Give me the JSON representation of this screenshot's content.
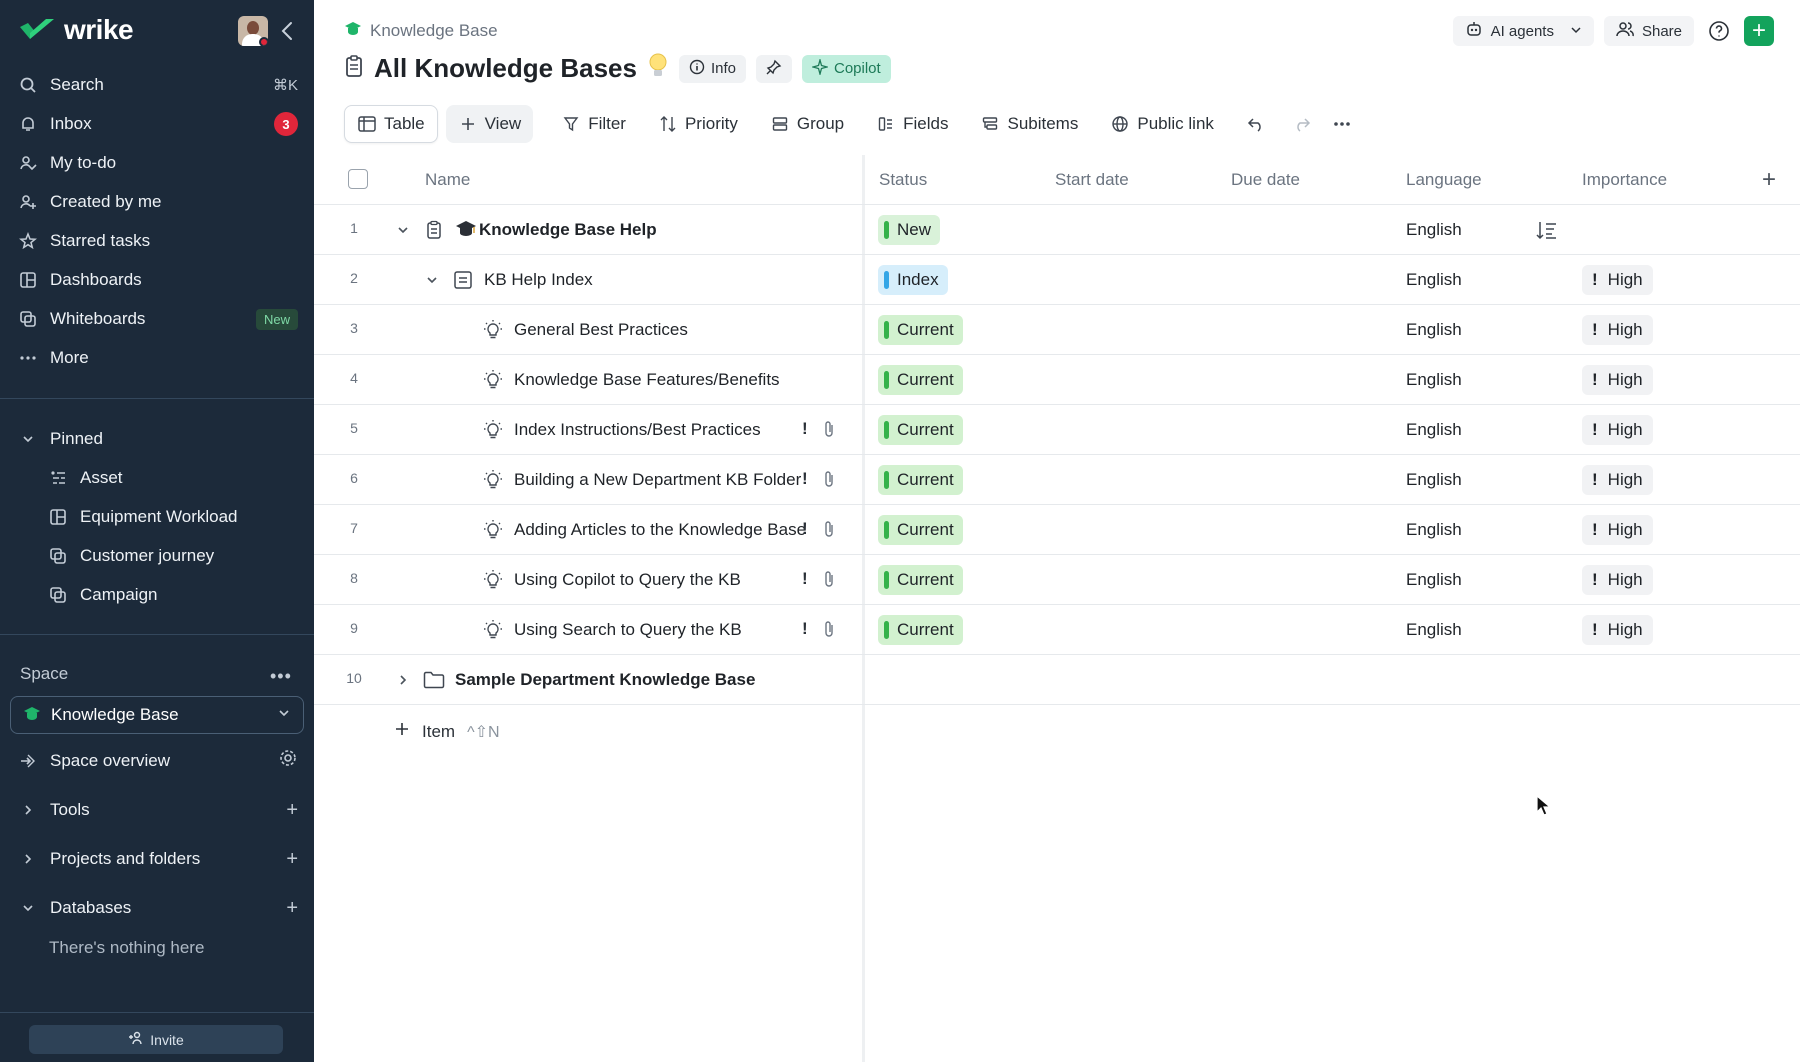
{
  "sidebar": {
    "logo": "wrike",
    "nav": [
      {
        "label": "Search",
        "shortcut": "⌘K",
        "icon": "search-icon"
      },
      {
        "label": "Inbox",
        "badge": "3",
        "icon": "bell-icon"
      },
      {
        "label": "My to-do",
        "icon": "user-check-icon"
      },
      {
        "label": "Created by me",
        "icon": "user-plus-icon"
      },
      {
        "label": "Starred tasks",
        "icon": "star-icon"
      },
      {
        "label": "Dashboards",
        "icon": "dashboard-icon"
      },
      {
        "label": "Whiteboards",
        "badge_new": "New",
        "icon": "whiteboard-icon"
      },
      {
        "label": "More",
        "icon": "more-icon"
      }
    ],
    "pinned_label": "Pinned",
    "pinned": [
      {
        "label": "Asset",
        "icon": "asset-icon"
      },
      {
        "label": "Equipment Workload",
        "icon": "dashboard-icon"
      },
      {
        "label": "Customer journey",
        "icon": "whiteboard-icon"
      },
      {
        "label": "Campaign",
        "icon": "whiteboard-icon"
      }
    ],
    "space_label": "Space",
    "space_selected": "Knowledge Base",
    "space_overview": "Space overview",
    "sections": [
      {
        "label": "Tools"
      },
      {
        "label": "Projects and folders"
      },
      {
        "label": "Databases"
      }
    ],
    "nothing_here": "There's nothing here",
    "invite": "Invite"
  },
  "header": {
    "breadcrumb": "Knowledge Base",
    "title": "All Knowledge Bases",
    "info": "Info",
    "copilot": "Copilot",
    "ai_agents": "AI agents",
    "share": "Share"
  },
  "toolbar": {
    "table": "Table",
    "view": "View",
    "filter": "Filter",
    "priority": "Priority",
    "group": "Group",
    "fields": "Fields",
    "subitems": "Subitems",
    "public_link": "Public link"
  },
  "table": {
    "columns": {
      "name": "Name",
      "status": "Status",
      "start_date": "Start date",
      "due_date": "Due date",
      "language": "Language",
      "importance": "Importance"
    },
    "rows": [
      {
        "n": "1",
        "name": "Knowledge Base Help",
        "status": "New",
        "language": "English",
        "importance": ""
      },
      {
        "n": "2",
        "name": "KB Help Index",
        "status": "Index",
        "language": "English",
        "importance": "High"
      },
      {
        "n": "3",
        "name": "General Best Practices",
        "status": "Current",
        "language": "English",
        "importance": "High"
      },
      {
        "n": "4",
        "name": "Knowledge Base Features/Benefits",
        "status": "Current",
        "language": "English",
        "importance": "High"
      },
      {
        "n": "5",
        "name": "Index Instructions/Best Practices",
        "status": "Current",
        "language": "English",
        "importance": "High"
      },
      {
        "n": "6",
        "name": "Building a New Department KB Folder",
        "status": "Current",
        "language": "English",
        "importance": "High"
      },
      {
        "n": "7",
        "name": "Adding Articles to the Knowledge Base",
        "status": "Current",
        "language": "English",
        "importance": "High"
      },
      {
        "n": "8",
        "name": "Using Copilot to Query the KB",
        "status": "Current",
        "language": "English",
        "importance": "High"
      },
      {
        "n": "9",
        "name": "Using Search to Query the KB",
        "status": "Current",
        "language": "English",
        "importance": "High"
      },
      {
        "n": "10",
        "name": "Sample Department Knowledge Base",
        "status": "",
        "language": "",
        "importance": ""
      }
    ],
    "add_item": "Item",
    "add_item_shortcut": "^⇧N",
    "importance_mark": "!",
    "row_flag": "!"
  },
  "colors": {
    "sidebar_bg": "#1c2a3a",
    "accent_green": "#13a35c",
    "status_green": "#35b24a",
    "status_blue": "#34a6e6"
  }
}
